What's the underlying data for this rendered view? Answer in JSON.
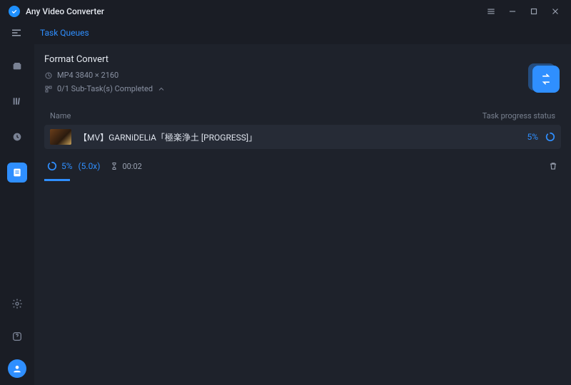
{
  "app": {
    "title": "Any Video Converter"
  },
  "header": {
    "task_queues_label": "Task Queues"
  },
  "section": {
    "title": "Format Convert",
    "format_line": "MP4 3840 × 2160",
    "subtask_line": "0/1 Sub-Task(s) Completed"
  },
  "table": {
    "col_name": "Name",
    "col_progress": "Task progress status"
  },
  "task": {
    "name": "【MV】GARNiDELiA「極楽浄土 [PROGRESS]」",
    "percent": "5%"
  },
  "status": {
    "percent": "5%",
    "multiplier": "(5.0x)",
    "elapsed": "00:02"
  },
  "colors": {
    "accent": "#2f8fff",
    "bg": "#1a1d25",
    "panel": "#1e222b"
  }
}
